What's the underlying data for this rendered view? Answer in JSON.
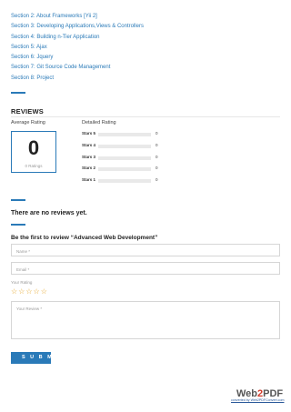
{
  "sections": [
    "Section 2: About Frameworks [Yii 2]",
    "Section 3: Developing Applications,Views & Controllers",
    "Section 4: Building n-Tier Application",
    "Section 5: Ajax",
    "Section 6: Jquery",
    "Section 7: Git Source Code Management",
    "Section 8: Project"
  ],
  "reviews": {
    "title": "REVIEWS",
    "average_label": "Average Rating",
    "average_value": "0",
    "ratings_count": "0 Ratings",
    "detailed_label": "Detailed Rating",
    "detailed": [
      {
        "label": "Stars 5",
        "count": "0"
      },
      {
        "label": "Stars 4",
        "count": "0"
      },
      {
        "label": "Stars 3",
        "count": "0"
      },
      {
        "label": "Stars 2",
        "count": "0"
      },
      {
        "label": "Stars 1",
        "count": "0"
      }
    ]
  },
  "no_reviews": "There are no reviews yet.",
  "form": {
    "heading": "Be the first to review “Advanced Web Development”",
    "name_placeholder": "Name *",
    "email_placeholder": "Email *",
    "rating_label": "Your Rating",
    "rating_value": 0,
    "stars_max": 5,
    "review_placeholder": "Your Review *",
    "submit_label": "SUBMIT"
  },
  "watermark": {
    "brand_web": "Web",
    "brand_2": "2",
    "brand_pdf": "PDF",
    "tagline": "converted by Web2PDFConvert.com"
  },
  "colors": {
    "accent": "#2a7ab8",
    "star": "#e4a11b"
  }
}
